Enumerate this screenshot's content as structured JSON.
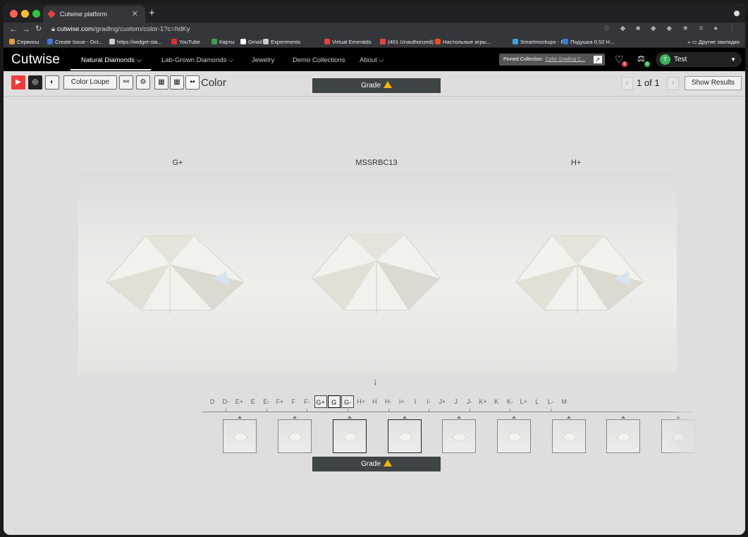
{
  "browser": {
    "tab_title": "Cutwise platform",
    "new_tab": "+",
    "url_host": "cutwise.com",
    "url_path": "/grading/custom/color-1?c=hdKy",
    "bookmarks": [
      {
        "label": "Сервисы",
        "color": "#e8a030"
      },
      {
        "label": "Create Issue - Oct...",
        "color": "#3a7ad8"
      },
      {
        "label": "https://widget-sta...",
        "color": "#cccccc"
      },
      {
        "label": "YouTube",
        "color": "#e03030"
      },
      {
        "label": "Карты",
        "color": "#3ca050"
      },
      {
        "label": "Gmail",
        "color": "#ffffff"
      },
      {
        "label": "Experiments",
        "color": "#cccccc"
      },
      {
        "label": "Virtual Emeralds",
        "color": "#e84040"
      },
      {
        "label": "(401 Unauthorized)",
        "color": "#e84040"
      },
      {
        "label": "Настольные игры...",
        "color": "#e85020"
      },
      {
        "label": "Smartmockups - F...",
        "color": "#3aa0e0"
      },
      {
        "label": "Подушка 0,52 H...",
        "color": "#3a7ad8"
      }
    ],
    "other_bookmarks": "Другие закладки"
  },
  "app_nav": {
    "logo": "Cutwise",
    "items": [
      "Natural Diamonds",
      "Lab-Grown Diamonds",
      "Jewelry",
      "Demo Collections",
      "About"
    ],
    "pinned_prefix": "Pinned Collection:",
    "pinned_name": "Color Grading C...",
    "favorites_count": "0",
    "compare_count": "0",
    "user_initial": "T",
    "user_name": "Test"
  },
  "toolbar": {
    "color_loupe": "Color Loupe",
    "section_title": "Color",
    "grade_label": "Grade",
    "page_current": "1",
    "page_of": "of",
    "page_total": "1",
    "show_results": "Show Results"
  },
  "stones": [
    {
      "label": "G+"
    },
    {
      "label": "MSSRBC13"
    },
    {
      "label": "H+"
    }
  ],
  "grade_scale": [
    "D",
    "D-",
    "E+",
    "E",
    "E-",
    "F+",
    "F",
    "F-",
    "G+",
    "G",
    "G-",
    "H+",
    "H",
    "H-",
    "I+",
    "I",
    "I-",
    "J+",
    "J",
    "J-",
    "K+",
    "K",
    "K-",
    "L+",
    "L",
    "L-",
    "M"
  ],
  "selected_grade": "G",
  "reference_grades": [
    "G+",
    "G-"
  ],
  "bottom_grade_label": "Grade",
  "colors": {
    "accent_red": "#f23b3b",
    "grade_bar": "#3f4446",
    "warning": "#f5b400",
    "user_avatar": "#3cb45a"
  }
}
